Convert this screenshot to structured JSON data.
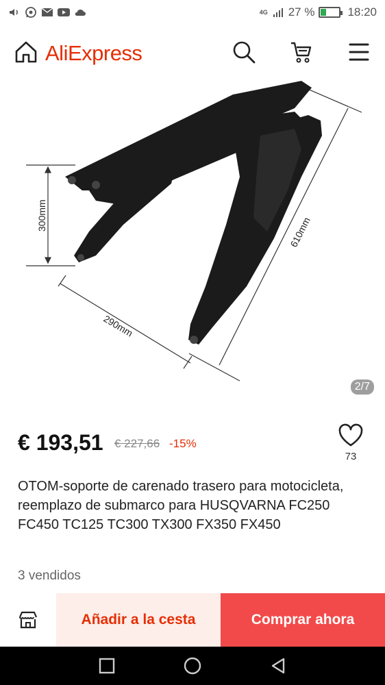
{
  "status_bar": {
    "left_icons": [
      "volume-icon",
      "whatsapp-icon",
      "mail-icon",
      "youtube-icon",
      "cloud-icon"
    ],
    "network": "4G",
    "battery_percent": "27 %",
    "battery_level": 0.27,
    "time": "18:20"
  },
  "header": {
    "logo_text": "AliExpress",
    "logo_color": "#e62e04",
    "icons": [
      "home-icon",
      "search-icon",
      "cart-icon",
      "menu-icon"
    ]
  },
  "product_image": {
    "dim_300": "300mm",
    "dim_610": "610mm",
    "dim_290": "290mm",
    "counter": "2/7"
  },
  "price": {
    "current": "€ 193,51",
    "original": "€ 227,66",
    "discount": "-15%",
    "wishlist_count": "73"
  },
  "product": {
    "title": "OTOM-soporte de carenado trasero para motocicleta, reemplazo de submarco para HUSQVARNA FC250 FC450 TC125 TC300 TX300 FX350 FX450",
    "sold": "3 vendidos"
  },
  "actions": {
    "add_to_cart": "Añadir a la cesta",
    "buy_now": "Comprar ahora",
    "accent": "#f24a4a"
  },
  "nav_bar": {
    "icons": [
      "recents-icon",
      "home-circle-icon",
      "back-icon"
    ]
  }
}
